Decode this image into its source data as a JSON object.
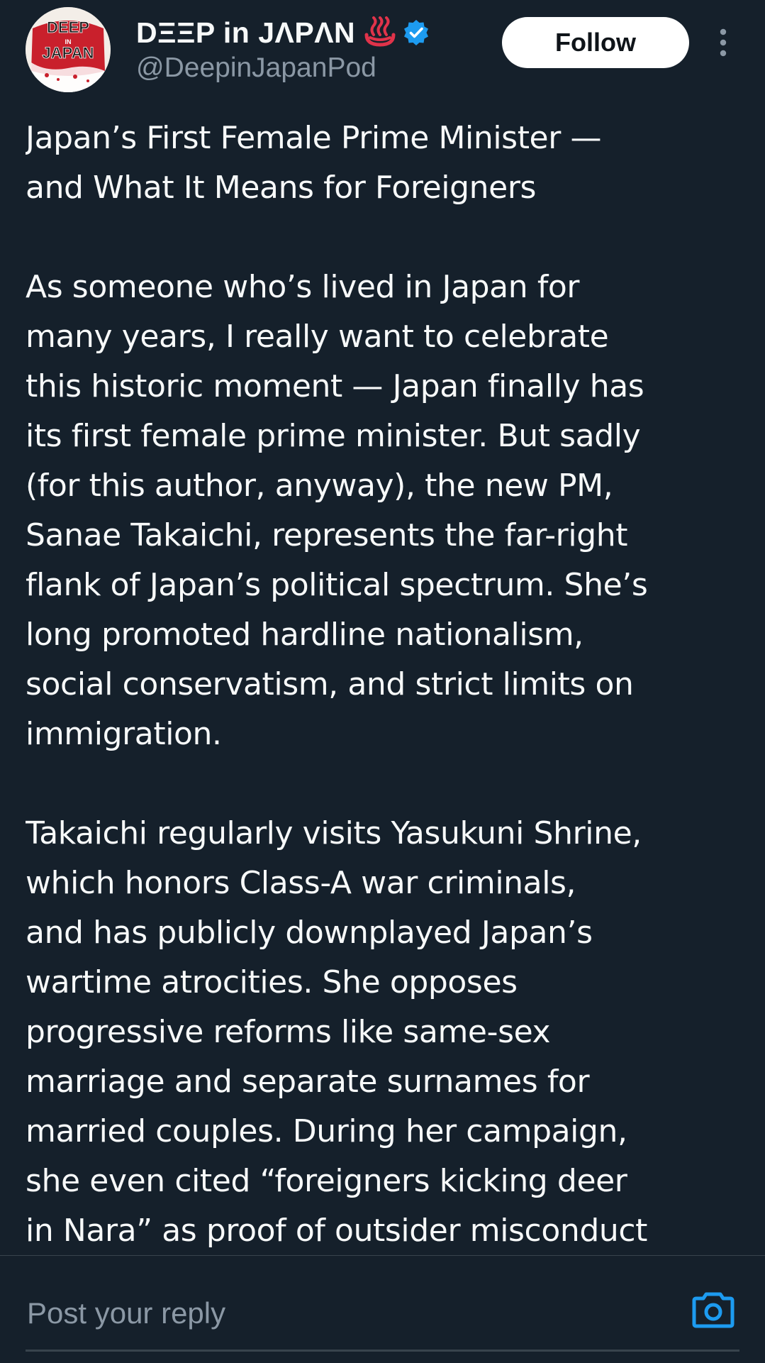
{
  "author": {
    "display_name": "DΞΞP in JΛPΛN",
    "handle": "@DeepinJapanPod",
    "avatar_logo_text": "DEEP IN JAPAN",
    "verified": true
  },
  "actions": {
    "follow_label": "Follow"
  },
  "post": {
    "paragraphs": [
      "Japan’s First Female Prime Minister —\nand What It Means for Foreigners",
      "As someone who’s lived in Japan for\nmany years, I really want to celebrate\nthis historic moment — Japan finally has\nits first female prime minister. But sadly\n(for this author, anyway), the new PM,\nSanae Takaichi, represents the far-right\nflank of Japan’s political spectrum. She’s\nlong promoted hardline nationalism,\nsocial conservatism, and strict limits on\nimmigration.",
      "Takaichi regularly visits Yasukuni Shrine,\nwhich honors Class-A war criminals,\nand has publicly downplayed Japan’s\nwartime atrocities. She opposes\nprogressive reforms like same-sex\nmarriage and separate surnames for\nmarried couples. During her campaign,\nshe even cited “foreigners kicking deer\nin Nara” as proof of outsider misconduct"
    ]
  },
  "reply": {
    "placeholder": "Post your reply"
  },
  "icons": {
    "hotspring": "hot-springs-emoji-icon",
    "verified": "verified-badge-icon",
    "more": "vertical-ellipsis-icon",
    "camera": "camera-icon"
  },
  "colors": {
    "background": "#15202b",
    "text": "#f7f9f9",
    "secondary_text": "#8b98a5",
    "accent": "#1d9bf0",
    "hotspring_red": "#e0334a",
    "divider": "#38444d"
  }
}
